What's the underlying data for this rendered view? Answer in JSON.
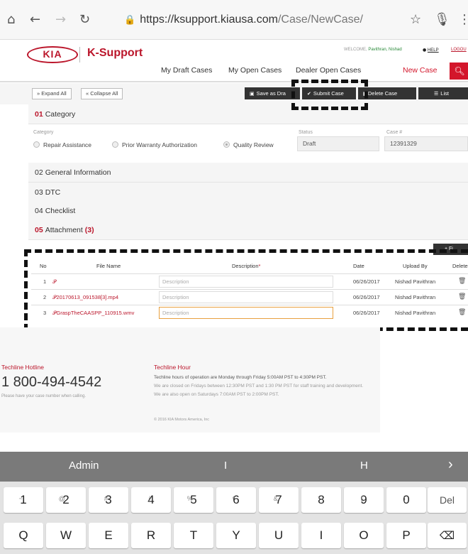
{
  "browser": {
    "url_host": "https://ksupport.kiausa.com",
    "url_path": "/Case/NewCase/",
    "icons": [
      "home-icon",
      "back-icon",
      "forward-icon",
      "reload-icon",
      "lock-icon",
      "star-icon",
      "mic-icon",
      "menu-icon"
    ]
  },
  "header": {
    "logo": "KIA",
    "brand": "K-Support",
    "welcome_label": "WELCOME,",
    "user_name": "Pavithran, Nishad",
    "help": "HELP",
    "logout": "LOGOU",
    "nav": {
      "draft": "My Draft Cases",
      "open": "My Open Cases",
      "dealer_open": "Dealer Open Cases",
      "new_case": "New Case"
    }
  },
  "toolbar": {
    "expand_all": "Expand All",
    "collapse_all": "Collapse All",
    "save_draft": "Save as Dra",
    "submit_case": "Submit Case",
    "delete_case": "Delete Case",
    "list": "List"
  },
  "sections": {
    "category": {
      "num": "01",
      "label": "Category"
    },
    "general": {
      "num": "02",
      "label": "General Information"
    },
    "dtc": {
      "num": "03",
      "label": "DTC"
    },
    "checklist": {
      "num": "04",
      "label": "Checklist"
    },
    "attachment": {
      "num": "05",
      "label": "Attachment",
      "count": "(3)"
    }
  },
  "category_form": {
    "category_label": "Category",
    "options": [
      "Repair Assistance",
      "Prior Warranty Authorization",
      "Quality Review"
    ],
    "selected": "Quality Review",
    "status_label": "Status",
    "status_value": "Draft",
    "case_label": "Case #",
    "case_value": "12391329"
  },
  "attachments": {
    "add_label": "+ Fi",
    "headers": {
      "no": "No",
      "file": "File Name",
      "desc": "Description",
      "required": "*",
      "date": "Date",
      "upload": "Upload By",
      "delete": "Delete"
    },
    "rows": [
      {
        "no": "1",
        "file": "",
        "desc_placeholder": "Description",
        "date": "06/26/2017",
        "by": "Nishad Pavithran"
      },
      {
        "no": "2",
        "file": "20170613_091538[3].mp4",
        "desc_placeholder": "Description",
        "date": "06/26/2017",
        "by": "Nishad Pavithran"
      },
      {
        "no": "3",
        "file": "GraspTheCAASPP_110915.wmv",
        "desc_placeholder": "Description",
        "date": "06/26/2017",
        "by": "Nishad Pavithran"
      }
    ]
  },
  "footer": {
    "hotline_title": "Techline Hotline",
    "phone": "1 800-494-4542",
    "phone_note": "Please have your case number when calling.",
    "hour_title": "Techline Hour",
    "hour_lines": [
      "Techline hours of operation are Monday through Friday 5:00AM PST to 4:30PM PST.",
      "We are closed on Fridays between 12:30PM PST and 1:30 PM PST for staff training and development.",
      "We are also open on Saturdays 7:00AM PST to 2:00PM PST."
    ],
    "copyright": "© 2016 KIA Motors America, Inc"
  },
  "keyboard": {
    "suggestions": [
      "Admin",
      "I",
      "H"
    ],
    "suggest_arrow": "›",
    "number_row": [
      {
        "k": "1",
        "s": "~"
      },
      {
        "k": "2",
        "s": "@"
      },
      {
        "k": "3",
        "s": "#"
      },
      {
        "k": "4",
        "s": "/"
      },
      {
        "k": "5",
        "s": "%"
      },
      {
        "k": "6",
        "s": "^"
      },
      {
        "k": "7",
        "s": "&"
      },
      {
        "k": "8",
        "s": "*"
      },
      {
        "k": "9",
        "s": "("
      },
      {
        "k": "0",
        "s": ")"
      }
    ],
    "del": "Del",
    "letter_row": [
      "Q",
      "W",
      "E",
      "R",
      "T",
      "Y",
      "U",
      "I",
      "O",
      "P"
    ],
    "backspace": "⌫"
  },
  "colors": {
    "brand_red": "#bb162b",
    "nav_red": "#d3162b",
    "dark_button": "#333333"
  }
}
